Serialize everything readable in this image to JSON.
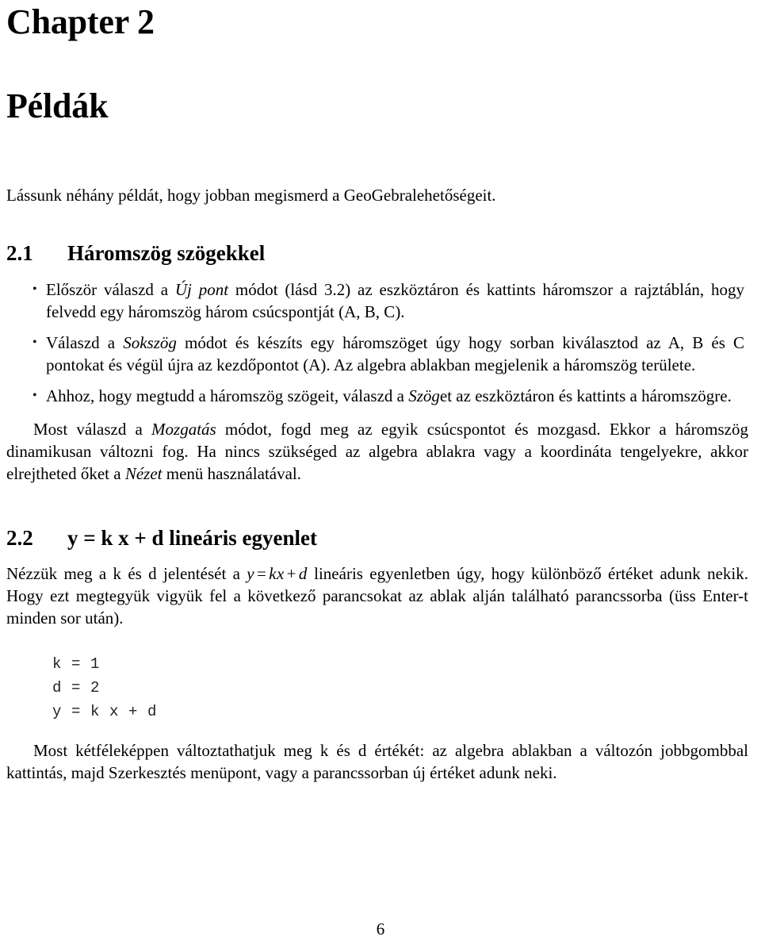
{
  "document": {
    "chapter_number": "Chapter 2",
    "chapter_title": "Példák",
    "page_number": "6"
  },
  "intro": {
    "text": "Lássunk néhány példát, hogy jobban megismerd a GeoGebralehetőségeit."
  },
  "sections": [
    {
      "number": "2.1",
      "title": "Háromszög szögekkel",
      "bullets": [
        {
          "part1": "Először válaszd a ",
          "emphasis": "Új pont",
          "part2": " módot (lásd  3.2) az eszköztáron és kattints háromszor a rajztáblán, hogy felvedd egy háromszög három csúcspontját (A, B, C)."
        },
        {
          "part1": "Válaszd a ",
          "emphasis": "Sokszög",
          "part2": " módot és készíts egy háromszöget úgy hogy sorban kiválasztod az A, B és C pontokat és végül újra az kezdőpontot (A). Az algebra ablakban megjelenik a háromszög területe."
        },
        {
          "part1": "Ahhoz, hogy megtudd a háromszög szögeit, válaszd a ",
          "emphasis": "Szög",
          "part2": "et az eszköztáron és kattints a háromszögre."
        }
      ],
      "paragraph": {
        "part1": "Most válaszd a ",
        "emphasis1": "Mozgatás",
        "part2": " módot, fogd meg az egyik csúcspontot és mozgasd. Ekkor a háromszög dinamikusan változni fog. Ha nincs szükséged az algebra ablakra vagy a koordináta tengelyekre, akkor elrejtheted őket a ",
        "emphasis2": "Nézet",
        "part3": " menü használatával."
      }
    },
    {
      "number": "2.2",
      "title": "y = k x + d lineáris egyenlet",
      "paragraph_before": {
        "part1": "Nézzük meg a k és d jelentését a ",
        "math": "y = kx + d",
        "math_lhs": "y",
        "math_eq": "=",
        "math_rhs1": "kx",
        "math_plus": "+",
        "math_rhs2": "d",
        "part2": " lineáris egyenletben úgy, hogy különböző értéket adunk nekik.  Hogy ezt megtegyük vigyük fel a következő parancsokat az ablak alján található parancssorba (üss Enter-t minden sor után)."
      },
      "code": "k = 1\nd = 2\ny = k x + d",
      "paragraph_after": "Most kétféleképpen változtathatjuk meg k és d értékét: az algebra ablakban a változón jobbgombbal kattintás, majd Szerkesztés menüpont, vagy a parancssorban új értéket adunk neki."
    }
  ],
  "symbols": {
    "bullet": "•"
  }
}
